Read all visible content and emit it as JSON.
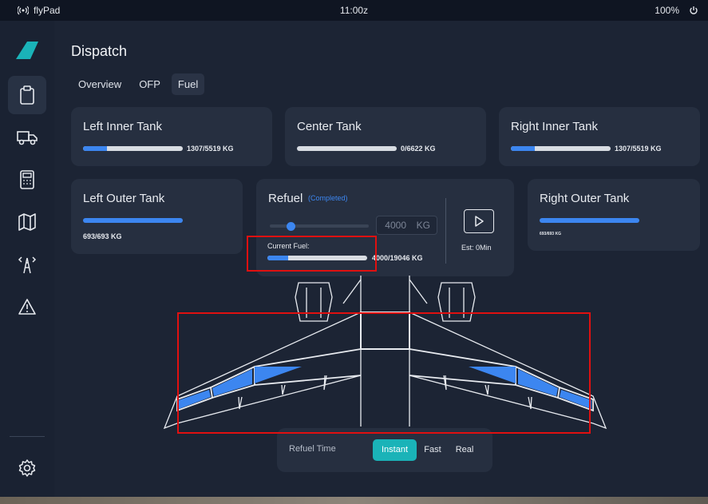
{
  "status_bar": {
    "app_name": "flyPad",
    "time": "11:00z",
    "battery": "100%"
  },
  "page": {
    "title": "Dispatch"
  },
  "tabs": [
    {
      "label": "Overview",
      "active": false
    },
    {
      "label": "OFP",
      "active": false
    },
    {
      "label": "Fuel",
      "active": true
    }
  ],
  "tanks": {
    "left_inner": {
      "label": "Left Inner Tank",
      "quantity": "1307/5519 KG",
      "fill": 0.237
    },
    "center": {
      "label": "Center Tank",
      "quantity": "0/6622 KG",
      "fill": 0.0
    },
    "right_inner": {
      "label": "Right Inner Tank",
      "quantity": "1307/5519 KG",
      "fill": 0.237
    },
    "left_outer": {
      "label": "Left Outer Tank",
      "quantity": "693/693 KG",
      "fill": 1.0
    },
    "right_outer": {
      "label": "Right Outer Tank",
      "quantity": "693/693 KG",
      "fill": 1.0
    }
  },
  "refuel": {
    "title": "Refuel",
    "status": "(Completed)",
    "target_value": "4000",
    "unit": "KG",
    "slider_fraction": 0.21,
    "current_fuel_label": "Current Fuel:",
    "current_fuel_value": "4000/19046 KG",
    "current_fuel_fraction": 0.21,
    "estimate": "Est: 0Min"
  },
  "refuel_time": {
    "label": "Refuel Time",
    "options": [
      {
        "label": "Instant",
        "active": true
      },
      {
        "label": "Fast",
        "active": false
      },
      {
        "label": "Real",
        "active": false
      }
    ]
  },
  "colors": {
    "accent": "#3c86f0",
    "teal": "#1ab3b8",
    "highlight": "#e01010",
    "background": "#1c2434",
    "card": "#262f40"
  },
  "icons": [
    "wifi-icon",
    "power-icon",
    "logo-icon",
    "clipboard-icon",
    "truck-icon",
    "calculator-icon",
    "map-icon",
    "tower-icon",
    "warning-icon",
    "settings-icon",
    "play-icon"
  ]
}
